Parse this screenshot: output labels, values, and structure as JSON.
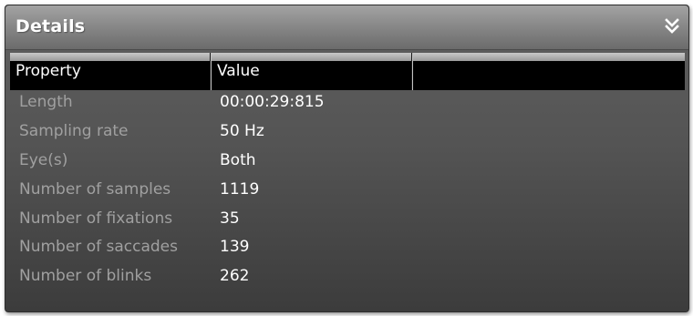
{
  "panel": {
    "title": "Details"
  },
  "columns": [
    {
      "label": "Property"
    },
    {
      "label": "Value"
    },
    {
      "label": ""
    }
  ],
  "rows": [
    {
      "property": "Length",
      "value": "00:00:29:815"
    },
    {
      "property": "Sampling rate",
      "value": "50 Hz"
    },
    {
      "property": "Eye(s)",
      "value": "Both"
    },
    {
      "property": "Number of samples",
      "value": "1119"
    },
    {
      "property": "Number of fixations",
      "value": "35"
    },
    {
      "property": "Number of saccades",
      "value": "139"
    },
    {
      "property": "Number of blinks",
      "value": "262"
    }
  ],
  "icons": {
    "collapse": "double-chevron-down-icon"
  },
  "colors": {
    "property_text": "#a0a0a0",
    "value_text": "#ffffff",
    "header_bg": "#000000"
  }
}
